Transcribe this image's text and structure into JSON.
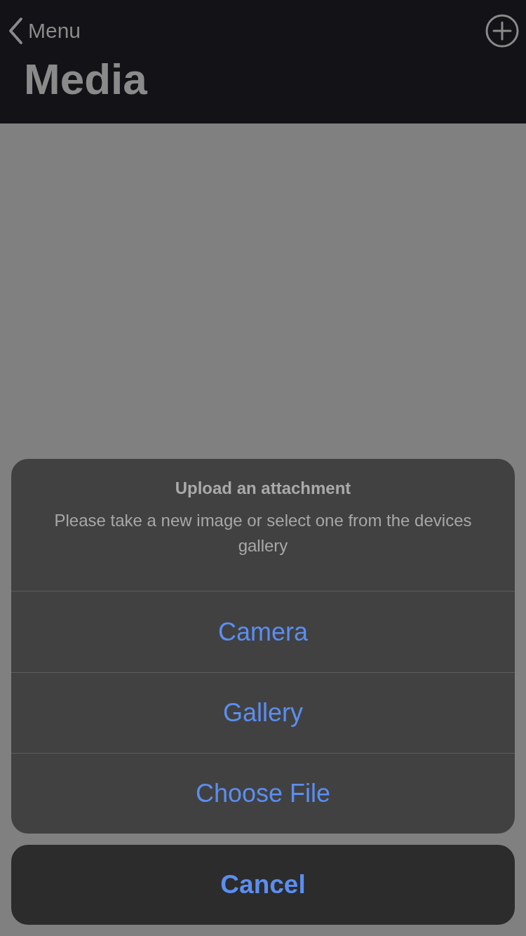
{
  "nav": {
    "back_label": "Menu",
    "title": "Media"
  },
  "action_sheet": {
    "title": "Upload an attachment",
    "message": "Please take a new image or select one from the devices gallery",
    "actions": [
      {
        "label": "Camera"
      },
      {
        "label": "Gallery"
      },
      {
        "label": "Choose File"
      }
    ],
    "cancel": "Cancel"
  }
}
